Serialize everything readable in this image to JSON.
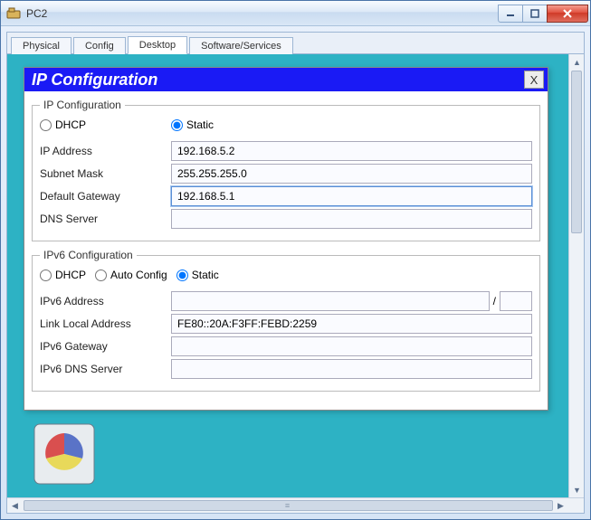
{
  "window": {
    "title": "PC2",
    "minimize_name": "minimize-button",
    "maximize_name": "maximize-button",
    "close_name": "close-button"
  },
  "tabs": [
    {
      "label": "Physical",
      "active": false
    },
    {
      "label": "Config",
      "active": false
    },
    {
      "label": "Desktop",
      "active": true
    },
    {
      "label": "Software/Services",
      "active": false
    }
  ],
  "dialog": {
    "title": "IP Configuration",
    "close_label": "X",
    "ipv4": {
      "legend": "IP Configuration",
      "modes": {
        "dhcp": "DHCP",
        "static": "Static",
        "selected": "static"
      },
      "fields": {
        "ip_label": "IP Address",
        "ip_value": "192.168.5.2",
        "mask_label": "Subnet Mask",
        "mask_value": "255.255.255.0",
        "gw_label": "Default Gateway",
        "gw_value": "192.168.5.1",
        "dns_label": "DNS Server",
        "dns_value": ""
      }
    },
    "ipv6": {
      "legend": "IPv6 Configuration",
      "modes": {
        "dhcp": "DHCP",
        "auto": "Auto Config",
        "static": "Static",
        "selected": "static"
      },
      "fields": {
        "addr_label": "IPv6 Address",
        "addr_value": "",
        "prefix_value": "",
        "ll_label": "Link Local Address",
        "ll_value": "FE80::20A:F3FF:FEBD:2259",
        "gw_label": "IPv6 Gateway",
        "gw_value": "",
        "dns_label": "IPv6 DNS Server",
        "dns_value": ""
      }
    }
  }
}
